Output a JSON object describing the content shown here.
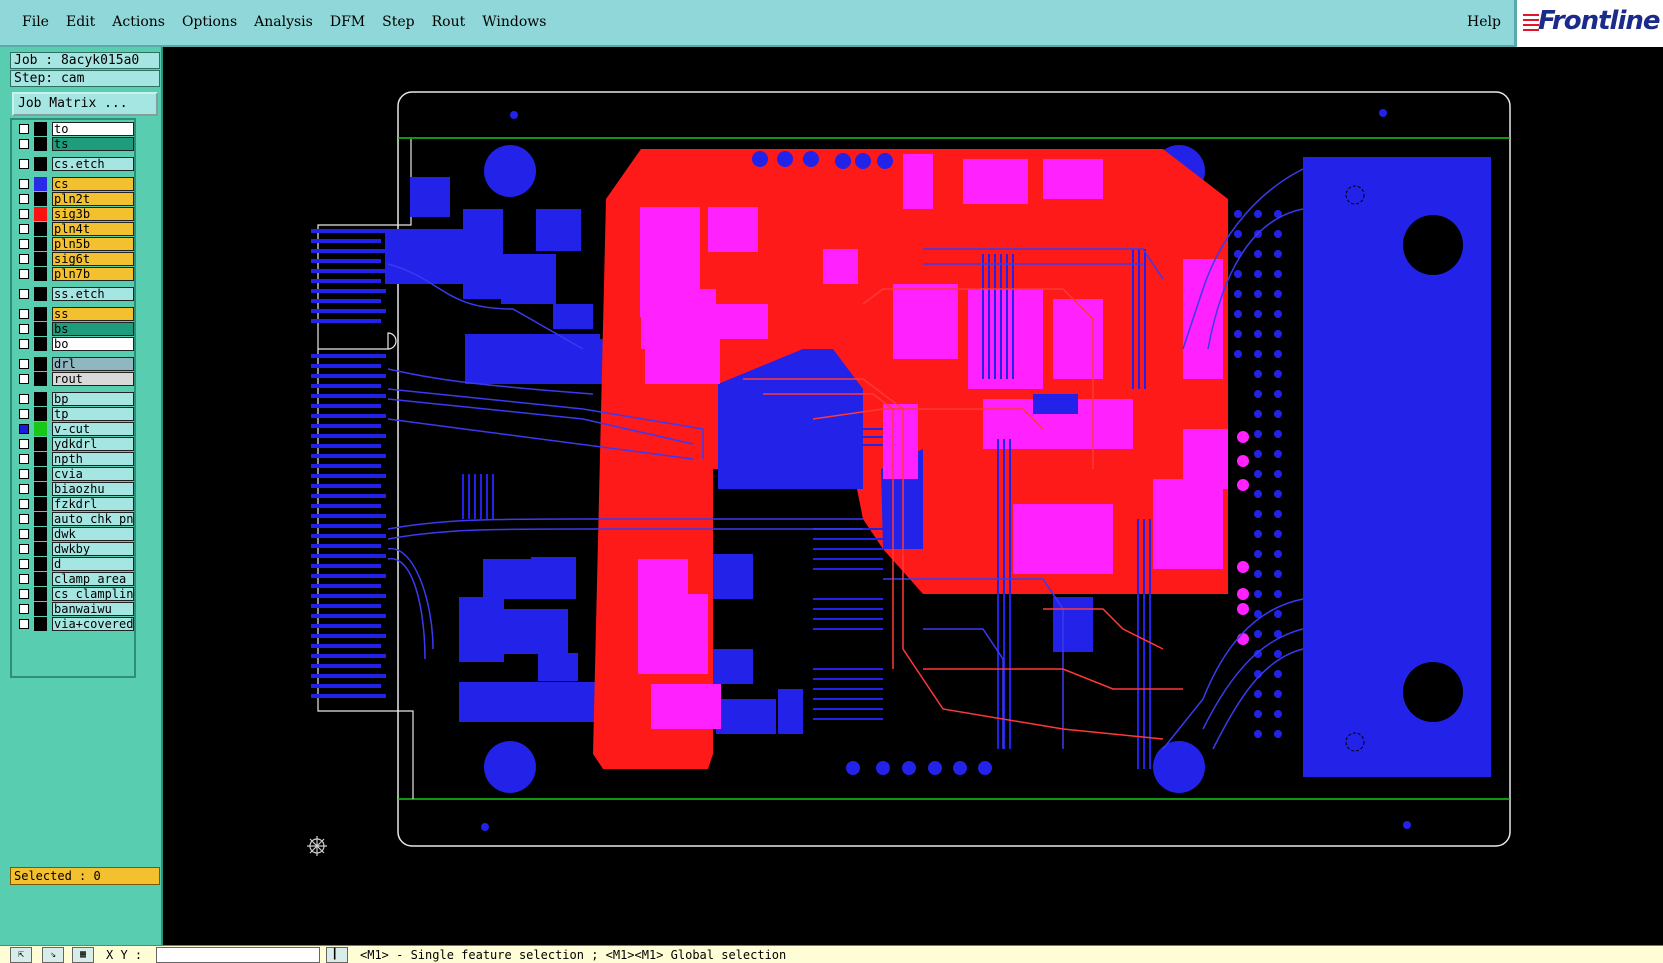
{
  "menubar": {
    "items": [
      "File",
      "Edit",
      "Actions",
      "Options",
      "Analysis",
      "DFM",
      "Step",
      "Rout",
      "Windows"
    ],
    "help": "Help",
    "logo": "Frontline"
  },
  "job": {
    "job_label": "Job : 8acyk015a0",
    "step_label": "Step: cam",
    "matrix_button": "Job Matrix ..."
  },
  "layers": [
    {
      "name": "to",
      "color": "#ffffff",
      "swatch": ""
    },
    {
      "name": "ts",
      "color": "#1f9c7c",
      "swatch": ""
    },
    {
      "name": "cs.etch",
      "color": "#a6e6e2",
      "swatch": ""
    },
    {
      "name": "cs",
      "color": "#f3c030",
      "swatch": "#2a2ae6"
    },
    {
      "name": "pln2t",
      "color": "#f3c030",
      "swatch": ""
    },
    {
      "name": "sig3b",
      "color": "#f3c030",
      "swatch": "#ff1010"
    },
    {
      "name": "pln4t",
      "color": "#f3c030",
      "swatch": ""
    },
    {
      "name": "pln5b",
      "color": "#f3c030",
      "swatch": ""
    },
    {
      "name": "sig6t",
      "color": "#f3c030",
      "swatch": ""
    },
    {
      "name": "pln7b",
      "color": "#f3c030",
      "swatch": ""
    },
    {
      "name": "ss.etch",
      "color": "#a6e6e2",
      "swatch": ""
    },
    {
      "name": "ss",
      "color": "#f3c030",
      "swatch": ""
    },
    {
      "name": "bs",
      "color": "#1f9c7c",
      "swatch": ""
    },
    {
      "name": "bo",
      "color": "#ffffff",
      "swatch": ""
    },
    {
      "name": "drl",
      "color": "#8fb7c0",
      "swatch": ""
    },
    {
      "name": "rout",
      "color": "#d9d9d9",
      "swatch": ""
    },
    {
      "name": "bp",
      "color": "#a6e6e2",
      "swatch": ""
    },
    {
      "name": "tp",
      "color": "#a6e6e2",
      "swatch": ""
    },
    {
      "name": "v-cut",
      "color": "#a6e6e2",
      "swatch": "#18c818",
      "checked": true
    },
    {
      "name": "ydkdrl",
      "color": "#a6e6e2",
      "swatch": ""
    },
    {
      "name": "npth",
      "color": "#a6e6e2",
      "swatch": ""
    },
    {
      "name": "cvia",
      "color": "#a6e6e2",
      "swatch": ""
    },
    {
      "name": "biaozhu",
      "color": "#a6e6e2",
      "swatch": ""
    },
    {
      "name": "fzkdrl",
      "color": "#a6e6e2",
      "swatch": ""
    },
    {
      "name": "auto_chk_pn",
      "color": "#a6e6e2",
      "swatch": ""
    },
    {
      "name": "dwk",
      "color": "#a6e6e2",
      "swatch": ""
    },
    {
      "name": "dwkby",
      "color": "#a6e6e2",
      "swatch": ""
    },
    {
      "name": "d",
      "color": "#a6e6e2",
      "swatch": ""
    },
    {
      "name": "clamp_area",
      "color": "#a6e6e2",
      "swatch": ""
    },
    {
      "name": "cs_clampline",
      "color": "#a6e6e2",
      "swatch": ""
    },
    {
      "name": "banwaiwu",
      "color": "#a6e6e2",
      "swatch": ""
    },
    {
      "name": "via+covered",
      "color": "#a6e6e2",
      "swatch": ""
    }
  ],
  "selected_label": "Selected : 0",
  "status": {
    "xy_label": "X Y :",
    "xy_value": "",
    "message": "<M1> - Single feature selection ; <M1><M1> Global selection"
  },
  "colors": {
    "menubar_bg": "#8fd7d8",
    "panel_bg": "#58cdb0",
    "board_blue": "#2222e8",
    "board_red": "#ff1a1a",
    "board_magenta": "#ff22ff",
    "vcut_green": "#18c818"
  }
}
